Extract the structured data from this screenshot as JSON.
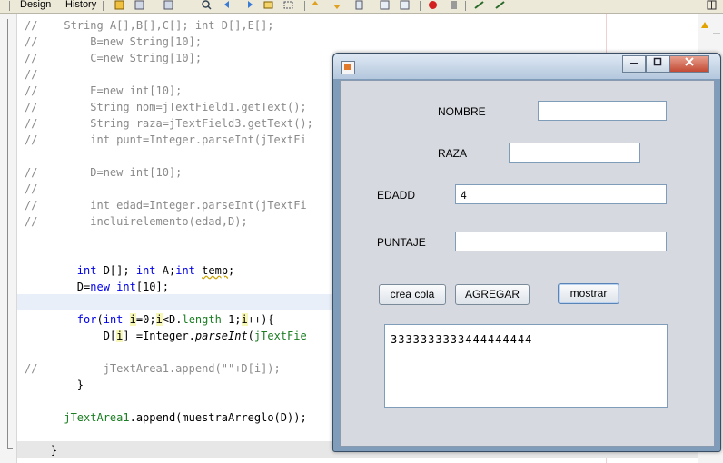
{
  "toolbar": {
    "tabs": [
      "Design",
      "History"
    ]
  },
  "editor": {
    "comment_lines": [
      "//    String A[],B[],C[]; int D[],E[];",
      "//        B=new String[10];",
      "//        C=new String[10];",
      "//",
      "//        E=new int[10];",
      "//        String nom=jTextField1.getText();",
      "//        String raza=jTextField3.getText();",
      "//        int punt=Integer.parseInt(jTextFi",
      "",
      "//        D=new int[10];",
      "//",
      "//        int edad=Integer.parseInt(jTextFi",
      "//        incluirelemento(edad,D);"
    ],
    "append_comment": "//          jTextArea1.append(\"\"+D[i]);"
  },
  "dialog": {
    "labels": {
      "nombre": "NOMBRE",
      "raza": "RAZA",
      "edad": "EDADD",
      "puntaje": "PUNTAJE"
    },
    "fields": {
      "nombre": "",
      "raza": "",
      "edad": "4",
      "puntaje": ""
    },
    "buttons": {
      "crea_cola": "crea cola",
      "agregar": "AGREGAR",
      "mostrar": "mostrar"
    },
    "textarea": "3333333333444444444"
  },
  "colors": {
    "keyword": "#0000e6",
    "comment": "#8a8a8a",
    "field": "#1a7d22"
  }
}
